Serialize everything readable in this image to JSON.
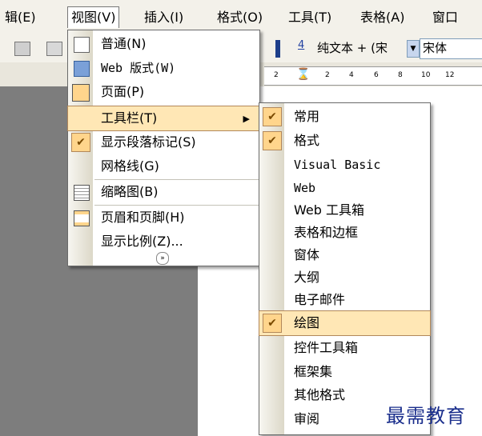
{
  "menubar": {
    "edit": "辑(E)",
    "view": "视图(V)",
    "insert": "插入(I)",
    "format": "格式(O)",
    "tools": "工具(T)",
    "table": "表格(A)",
    "window": "窗口"
  },
  "toolbar": {
    "style_icon": "4",
    "style_value": "纯文本 + (宋",
    "font_value": "宋体"
  },
  "ruler": {
    "ticks": [
      "2",
      "2",
      "4",
      "6",
      "8",
      "10",
      "12"
    ]
  },
  "view_menu": {
    "items": [
      {
        "label": "普通(N)"
      },
      {
        "label": "Web 版式(W)"
      },
      {
        "label": "页面(P)"
      },
      {
        "label": "工具栏(T)"
      },
      {
        "label": "显示段落标记(S)"
      },
      {
        "label": "网格线(G)"
      },
      {
        "label": "缩略图(B)"
      },
      {
        "label": "页眉和页脚(H)"
      },
      {
        "label": "显示比例(Z)..."
      }
    ]
  },
  "toolbars_submenu": {
    "items": [
      {
        "label": "常用",
        "checked": true
      },
      {
        "label": "格式",
        "checked": true
      },
      {
        "label": "Visual Basic",
        "checked": false
      },
      {
        "label": "Web",
        "checked": false
      },
      {
        "label": "Web 工具箱",
        "checked": false
      },
      {
        "label": "表格和边框",
        "checked": false
      },
      {
        "label": "窗体",
        "checked": false
      },
      {
        "label": "大纲",
        "checked": false
      },
      {
        "label": "电子邮件",
        "checked": false
      },
      {
        "label": "绘图",
        "checked": true
      },
      {
        "label": "控件工具箱",
        "checked": false
      },
      {
        "label": "框架集",
        "checked": false
      },
      {
        "label": "其他格式",
        "checked": false
      },
      {
        "label": "审阅",
        "checked": false
      }
    ]
  },
  "watermark": "最需教育",
  "colors": {
    "highlight": "#ffe7b5",
    "check": "#ffd58c",
    "watermark": "#1a2e8c"
  }
}
